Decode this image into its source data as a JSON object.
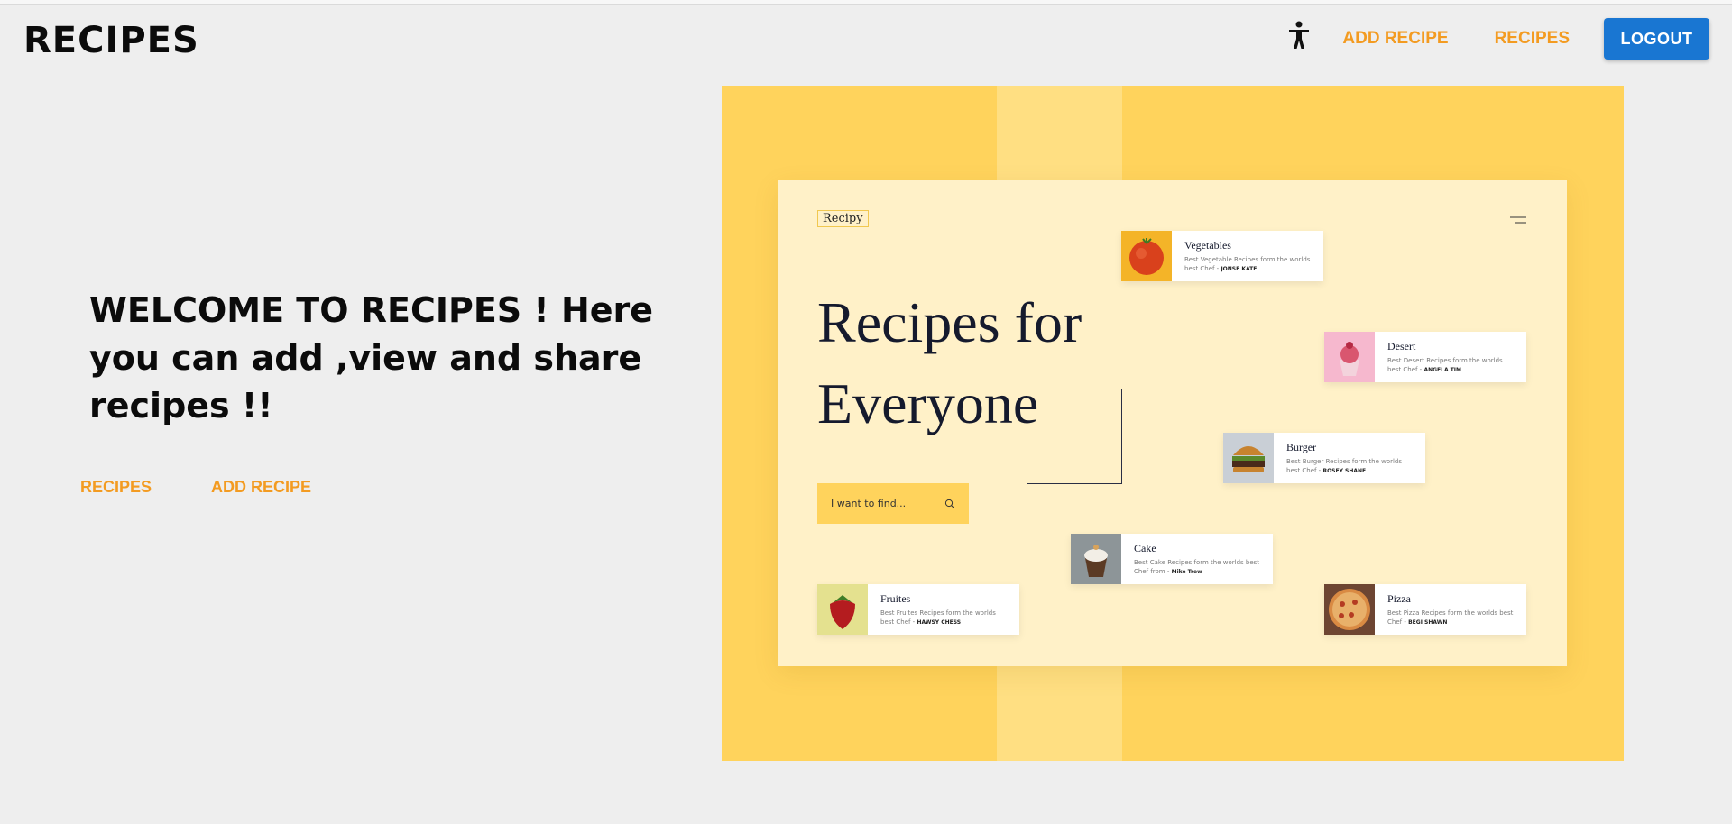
{
  "header": {
    "brand": "RECIPES",
    "nav": {
      "add_recipe": "ADD RECIPE",
      "recipes": "RECIPES",
      "logout": "LOGOUT"
    },
    "icons": {
      "accessibility": "accessibility-person-icon"
    }
  },
  "hero": {
    "welcome": "WELCOME TO RECIPES ! Here you can add ,view and share recipes !!",
    "links": {
      "recipes": "RECIPES",
      "add_recipe": "ADD RECIPE"
    }
  },
  "showcase": {
    "logo": "Recipy",
    "headline": "Recipes for Everyone",
    "search_placeholder": "I want to find...",
    "cards": [
      {
        "title": "Vegetables",
        "desc": "Best Vegetable Recipes form the worlds best Chef -",
        "chef": "JONSE KATE",
        "thumb": "tomato"
      },
      {
        "title": "Desert",
        "desc": "Best Desert Recipes form the worlds best Chef -",
        "chef": "ANGELA TIM",
        "thumb": "cupcake"
      },
      {
        "title": "Burger",
        "desc": "Best Burger Recipes form the worlds best Chef -",
        "chef": "ROSEY SHANE",
        "thumb": "burger"
      },
      {
        "title": "Cake",
        "desc": "Best Cake Recipes form the worlds best Chef from -",
        "chef": "Mike Trew",
        "thumb": "cake"
      },
      {
        "title": "Fruites",
        "desc": "Best Fruites Recipes form the worlds best Chef -",
        "chef": "HAWSY CHESS",
        "thumb": "strawberry"
      },
      {
        "title": "Pizza",
        "desc": "Best Pizza Recipes form the worlds best Chef -",
        "chef": "BEGI SHAWN",
        "thumb": "pizza"
      }
    ]
  },
  "colors": {
    "accent": "#f39b21",
    "logout": "#1976d2",
    "showcase_bg": "#ffd35c",
    "card_bg": "#fff1c8"
  }
}
